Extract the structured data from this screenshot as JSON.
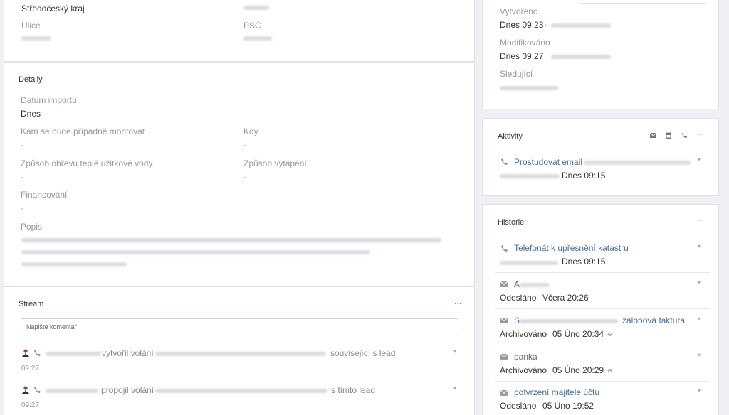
{
  "address": {
    "region": "Středočeský kraj",
    "street_label": "Ulice",
    "zip_label": "PSČ"
  },
  "details": {
    "title": "Detaily",
    "import_date_label": "Datum importu",
    "import_date_value": "Dnes",
    "mount_label": "Kam se bude případně montovat",
    "mount_value": "-",
    "when_label": "Kdy",
    "when_value": "-",
    "water_label": "Způsob ohřevu teplé užitkové vody",
    "water_value": "-",
    "heating_label": "Způsob vytápění",
    "heating_value": "-",
    "financing_label": "Financování",
    "financing_value": "-",
    "description_label": "Popis"
  },
  "stream": {
    "title": "Stream",
    "more": "···",
    "comment_placeholder": "Napište komentář",
    "items": [
      {
        "action": "vytvořil volání",
        "suffix": "související s lead",
        "time": "09:27"
      },
      {
        "action": "propojil volání",
        "suffix": "s tímto lead",
        "time": "09:27"
      }
    ]
  },
  "meta": {
    "created_label": "Vytvořeno",
    "created_value": "Dnes 09:23",
    "modified_label": "Modifikováno",
    "modified_value": "Dnes 09:27",
    "followers_label": "Sledující"
  },
  "activities": {
    "title": "Aktivity",
    "more": "···",
    "items": [
      {
        "icon": "phone-icon",
        "title": "Prostudovat email",
        "time": "Dnes 09:15"
      }
    ]
  },
  "history": {
    "title": "Historie",
    "more": "···",
    "items": [
      {
        "icon": "phone-icon",
        "title": "Telefonát k upřesnění katastru",
        "status": "",
        "time": "Dnes 09:15"
      },
      {
        "icon": "envelope-icon",
        "title": "A",
        "status": "Odesláno",
        "time": "Včera 20:26"
      },
      {
        "icon": "envelope-icon",
        "title_prefix": "S",
        "title": "zálohová faktura",
        "status": "Archivováno",
        "time": "05 Úno 20:34"
      },
      {
        "icon": "envelope-icon",
        "title": "banka",
        "status": "Archivováno",
        "time": "05 Úno 20:29"
      },
      {
        "icon": "envelope-icon",
        "title": "potvrzení majitele účtu",
        "status": "Odesláno",
        "time": "05 Úno 19:52"
      }
    ]
  },
  "colors": {
    "link": "#4f6d91",
    "border": "#dfe3e8",
    "background": "#eef0f3"
  }
}
